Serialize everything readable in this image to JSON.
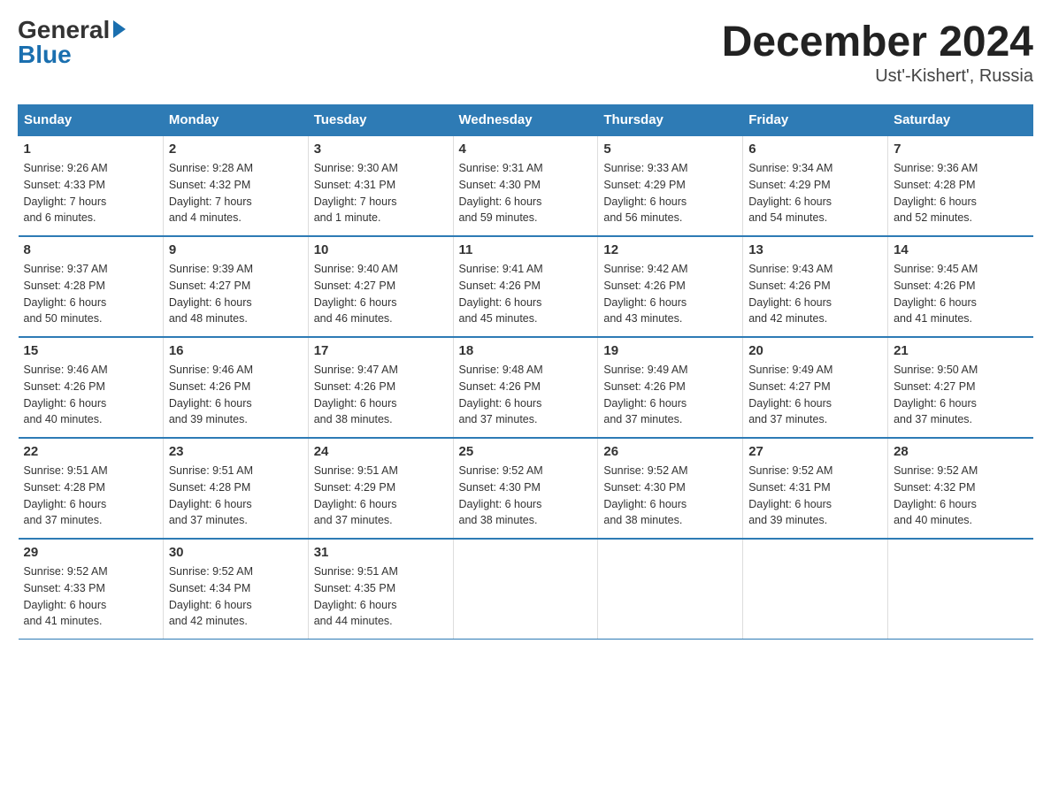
{
  "header": {
    "logo_general": "General",
    "logo_blue": "Blue",
    "month_title": "December 2024",
    "location": "Ust'-Kishert', Russia"
  },
  "days_of_week": [
    "Sunday",
    "Monday",
    "Tuesday",
    "Wednesday",
    "Thursday",
    "Friday",
    "Saturday"
  ],
  "weeks": [
    [
      {
        "day": "1",
        "info": "Sunrise: 9:26 AM\nSunset: 4:33 PM\nDaylight: 7 hours\nand 6 minutes."
      },
      {
        "day": "2",
        "info": "Sunrise: 9:28 AM\nSunset: 4:32 PM\nDaylight: 7 hours\nand 4 minutes."
      },
      {
        "day": "3",
        "info": "Sunrise: 9:30 AM\nSunset: 4:31 PM\nDaylight: 7 hours\nand 1 minute."
      },
      {
        "day": "4",
        "info": "Sunrise: 9:31 AM\nSunset: 4:30 PM\nDaylight: 6 hours\nand 59 minutes."
      },
      {
        "day": "5",
        "info": "Sunrise: 9:33 AM\nSunset: 4:29 PM\nDaylight: 6 hours\nand 56 minutes."
      },
      {
        "day": "6",
        "info": "Sunrise: 9:34 AM\nSunset: 4:29 PM\nDaylight: 6 hours\nand 54 minutes."
      },
      {
        "day": "7",
        "info": "Sunrise: 9:36 AM\nSunset: 4:28 PM\nDaylight: 6 hours\nand 52 minutes."
      }
    ],
    [
      {
        "day": "8",
        "info": "Sunrise: 9:37 AM\nSunset: 4:28 PM\nDaylight: 6 hours\nand 50 minutes."
      },
      {
        "day": "9",
        "info": "Sunrise: 9:39 AM\nSunset: 4:27 PM\nDaylight: 6 hours\nand 48 minutes."
      },
      {
        "day": "10",
        "info": "Sunrise: 9:40 AM\nSunset: 4:27 PM\nDaylight: 6 hours\nand 46 minutes."
      },
      {
        "day": "11",
        "info": "Sunrise: 9:41 AM\nSunset: 4:26 PM\nDaylight: 6 hours\nand 45 minutes."
      },
      {
        "day": "12",
        "info": "Sunrise: 9:42 AM\nSunset: 4:26 PM\nDaylight: 6 hours\nand 43 minutes."
      },
      {
        "day": "13",
        "info": "Sunrise: 9:43 AM\nSunset: 4:26 PM\nDaylight: 6 hours\nand 42 minutes."
      },
      {
        "day": "14",
        "info": "Sunrise: 9:45 AM\nSunset: 4:26 PM\nDaylight: 6 hours\nand 41 minutes."
      }
    ],
    [
      {
        "day": "15",
        "info": "Sunrise: 9:46 AM\nSunset: 4:26 PM\nDaylight: 6 hours\nand 40 minutes."
      },
      {
        "day": "16",
        "info": "Sunrise: 9:46 AM\nSunset: 4:26 PM\nDaylight: 6 hours\nand 39 minutes."
      },
      {
        "day": "17",
        "info": "Sunrise: 9:47 AM\nSunset: 4:26 PM\nDaylight: 6 hours\nand 38 minutes."
      },
      {
        "day": "18",
        "info": "Sunrise: 9:48 AM\nSunset: 4:26 PM\nDaylight: 6 hours\nand 37 minutes."
      },
      {
        "day": "19",
        "info": "Sunrise: 9:49 AM\nSunset: 4:26 PM\nDaylight: 6 hours\nand 37 minutes."
      },
      {
        "day": "20",
        "info": "Sunrise: 9:49 AM\nSunset: 4:27 PM\nDaylight: 6 hours\nand 37 minutes."
      },
      {
        "day": "21",
        "info": "Sunrise: 9:50 AM\nSunset: 4:27 PM\nDaylight: 6 hours\nand 37 minutes."
      }
    ],
    [
      {
        "day": "22",
        "info": "Sunrise: 9:51 AM\nSunset: 4:28 PM\nDaylight: 6 hours\nand 37 minutes."
      },
      {
        "day": "23",
        "info": "Sunrise: 9:51 AM\nSunset: 4:28 PM\nDaylight: 6 hours\nand 37 minutes."
      },
      {
        "day": "24",
        "info": "Sunrise: 9:51 AM\nSunset: 4:29 PM\nDaylight: 6 hours\nand 37 minutes."
      },
      {
        "day": "25",
        "info": "Sunrise: 9:52 AM\nSunset: 4:30 PM\nDaylight: 6 hours\nand 38 minutes."
      },
      {
        "day": "26",
        "info": "Sunrise: 9:52 AM\nSunset: 4:30 PM\nDaylight: 6 hours\nand 38 minutes."
      },
      {
        "day": "27",
        "info": "Sunrise: 9:52 AM\nSunset: 4:31 PM\nDaylight: 6 hours\nand 39 minutes."
      },
      {
        "day": "28",
        "info": "Sunrise: 9:52 AM\nSunset: 4:32 PM\nDaylight: 6 hours\nand 40 minutes."
      }
    ],
    [
      {
        "day": "29",
        "info": "Sunrise: 9:52 AM\nSunset: 4:33 PM\nDaylight: 6 hours\nand 41 minutes."
      },
      {
        "day": "30",
        "info": "Sunrise: 9:52 AM\nSunset: 4:34 PM\nDaylight: 6 hours\nand 42 minutes."
      },
      {
        "day": "31",
        "info": "Sunrise: 9:51 AM\nSunset: 4:35 PM\nDaylight: 6 hours\nand 44 minutes."
      },
      {
        "day": "",
        "info": ""
      },
      {
        "day": "",
        "info": ""
      },
      {
        "day": "",
        "info": ""
      },
      {
        "day": "",
        "info": ""
      }
    ]
  ]
}
